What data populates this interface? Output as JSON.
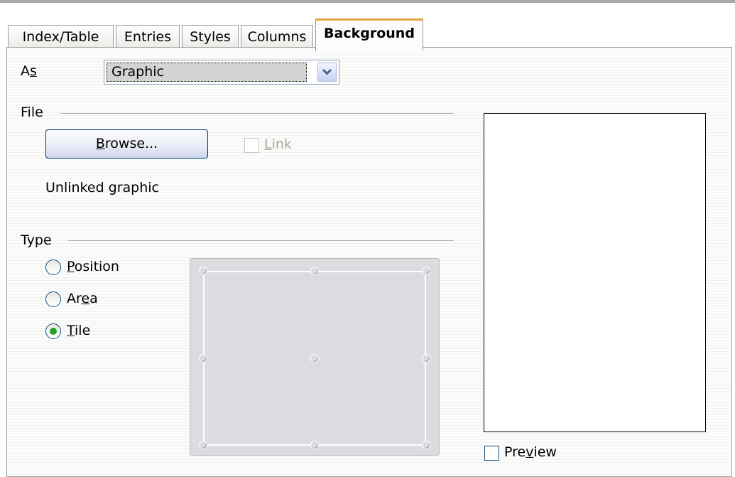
{
  "tabs": [
    {
      "label": "Index/Table",
      "active": false
    },
    {
      "label": "Entries",
      "active": false
    },
    {
      "label": "Styles",
      "active": false
    },
    {
      "label": "Columns",
      "active": false
    },
    {
      "label": "Background",
      "active": true
    }
  ],
  "as_field": {
    "label_pre": "A",
    "label_mnemonic": "s",
    "selected": "Graphic"
  },
  "file_section": {
    "heading": "File",
    "browse_pre": "",
    "browse_mnemonic": "B",
    "browse_post": "rowse...",
    "link_pre": "",
    "link_mnemonic": "L",
    "link_post": "ink",
    "link_checked": false,
    "link_enabled": false,
    "status_text": "Unlinked graphic"
  },
  "type_section": {
    "heading": "Type",
    "options": [
      {
        "pre": "",
        "mnemonic": "P",
        "post": "osition",
        "selected": false
      },
      {
        "pre": "Ar",
        "mnemonic": "e",
        "post": "a",
        "selected": false
      },
      {
        "pre": "",
        "mnemonic": "T",
        "post": "ile",
        "selected": true
      }
    ]
  },
  "preview_checkbox": {
    "pre": "Pre",
    "mnemonic": "v",
    "post": "iew",
    "checked": false
  },
  "colors": {
    "active_tab_accent": "#e7a33b",
    "radio_selected": "#21a121"
  }
}
